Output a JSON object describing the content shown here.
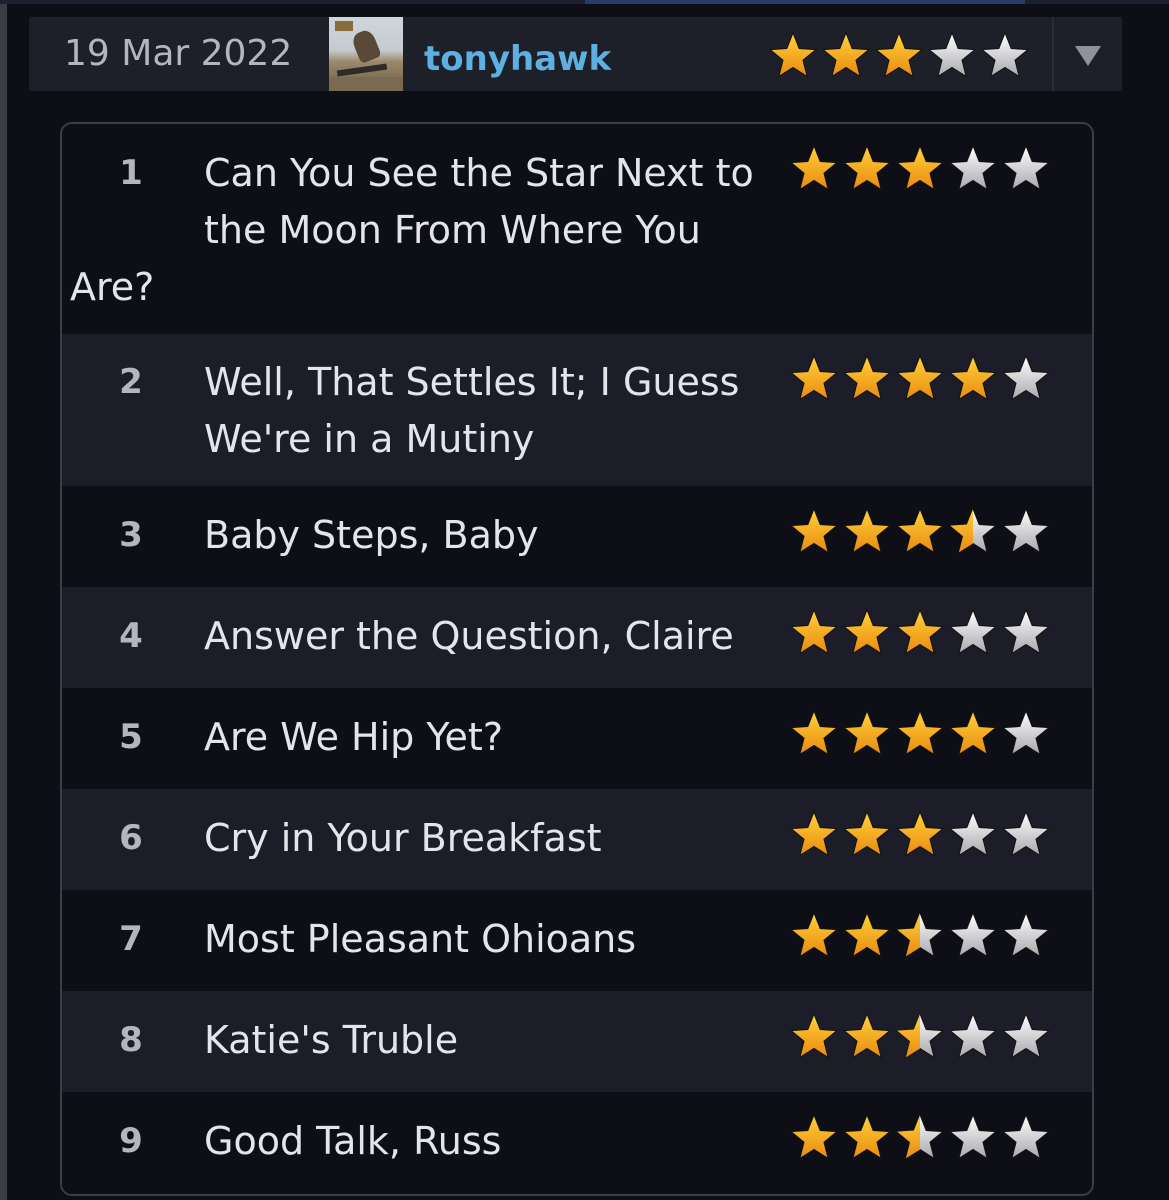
{
  "review": {
    "date": "19 Mar 2022",
    "username": "tonyhawk",
    "rating": 3,
    "rating_max": 5,
    "dropdown_icon": "triangle-down-icon"
  },
  "tracks": [
    {
      "number": "1",
      "title_main": "Can You See the Star Next to the Moon From Where You",
      "title_overflow": "Are?",
      "rating": 3
    },
    {
      "number": "2",
      "title_main": "Well, That Settles It; I Guess We're in a Mutiny",
      "rating": 4
    },
    {
      "number": "3",
      "title_main": "Baby Steps, Baby",
      "rating": 3.5
    },
    {
      "number": "4",
      "title_main": "Answer the Question, Claire",
      "rating": 3
    },
    {
      "number": "5",
      "title_main": "Are We Hip Yet?",
      "rating": 4
    },
    {
      "number": "6",
      "title_main": "Cry in Your Breakfast",
      "rating": 3
    },
    {
      "number": "7",
      "title_main": "Most Pleasant Ohioans",
      "rating": 2.5
    },
    {
      "number": "8",
      "title_main": "Katie's Truble",
      "rating": 2.5
    },
    {
      "number": "9",
      "title_main": "Good Talk, Russ",
      "rating": 2.5
    }
  ],
  "colors": {
    "star_filled_top": "#ffd23a",
    "star_filled_bottom": "#e98a10",
    "star_empty_top": "#ffffff",
    "star_empty_bottom": "#a9a9ae",
    "username": "#5fb0e2"
  }
}
